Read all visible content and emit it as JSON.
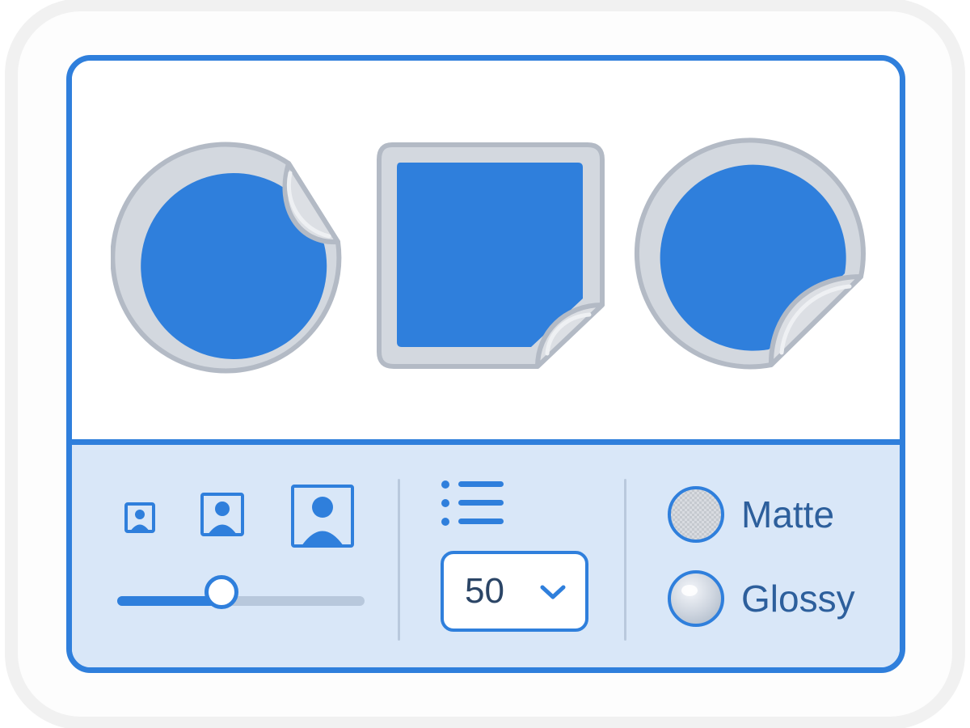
{
  "sticker_shapes": [
    {
      "shape": "circle",
      "icon": "circle-sticker-icon",
      "peel_corner": "top-right"
    },
    {
      "shape": "square",
      "icon": "square-sticker-icon",
      "peel_corner": "bottom-right"
    },
    {
      "shape": "circle",
      "icon": "circle-sticker-icon",
      "peel_corner": "bottom-right"
    }
  ],
  "size": {
    "options": [
      {
        "level": "small",
        "icon": "portrait-icon"
      },
      {
        "level": "medium",
        "icon": "portrait-icon"
      },
      {
        "level": "large",
        "icon": "portrait-icon"
      }
    ],
    "slider_value": 0.42
  },
  "quantity": {
    "icon": "list-icon",
    "selected": "50",
    "dropdown_icon": "chevron-down-icon"
  },
  "finish": {
    "options": [
      {
        "label": "Matte",
        "icon": "matte-swatch-icon"
      },
      {
        "label": "Glossy",
        "icon": "glossy-swatch-icon"
      }
    ]
  },
  "colors": {
    "accent": "#2f7fdc",
    "sticker_fill": "#2f7fdc",
    "sticker_border": "#b7bec8",
    "peel": "#dcdfe4",
    "controls_bg": "#d9e7f8",
    "text": "#2d5f9c"
  }
}
